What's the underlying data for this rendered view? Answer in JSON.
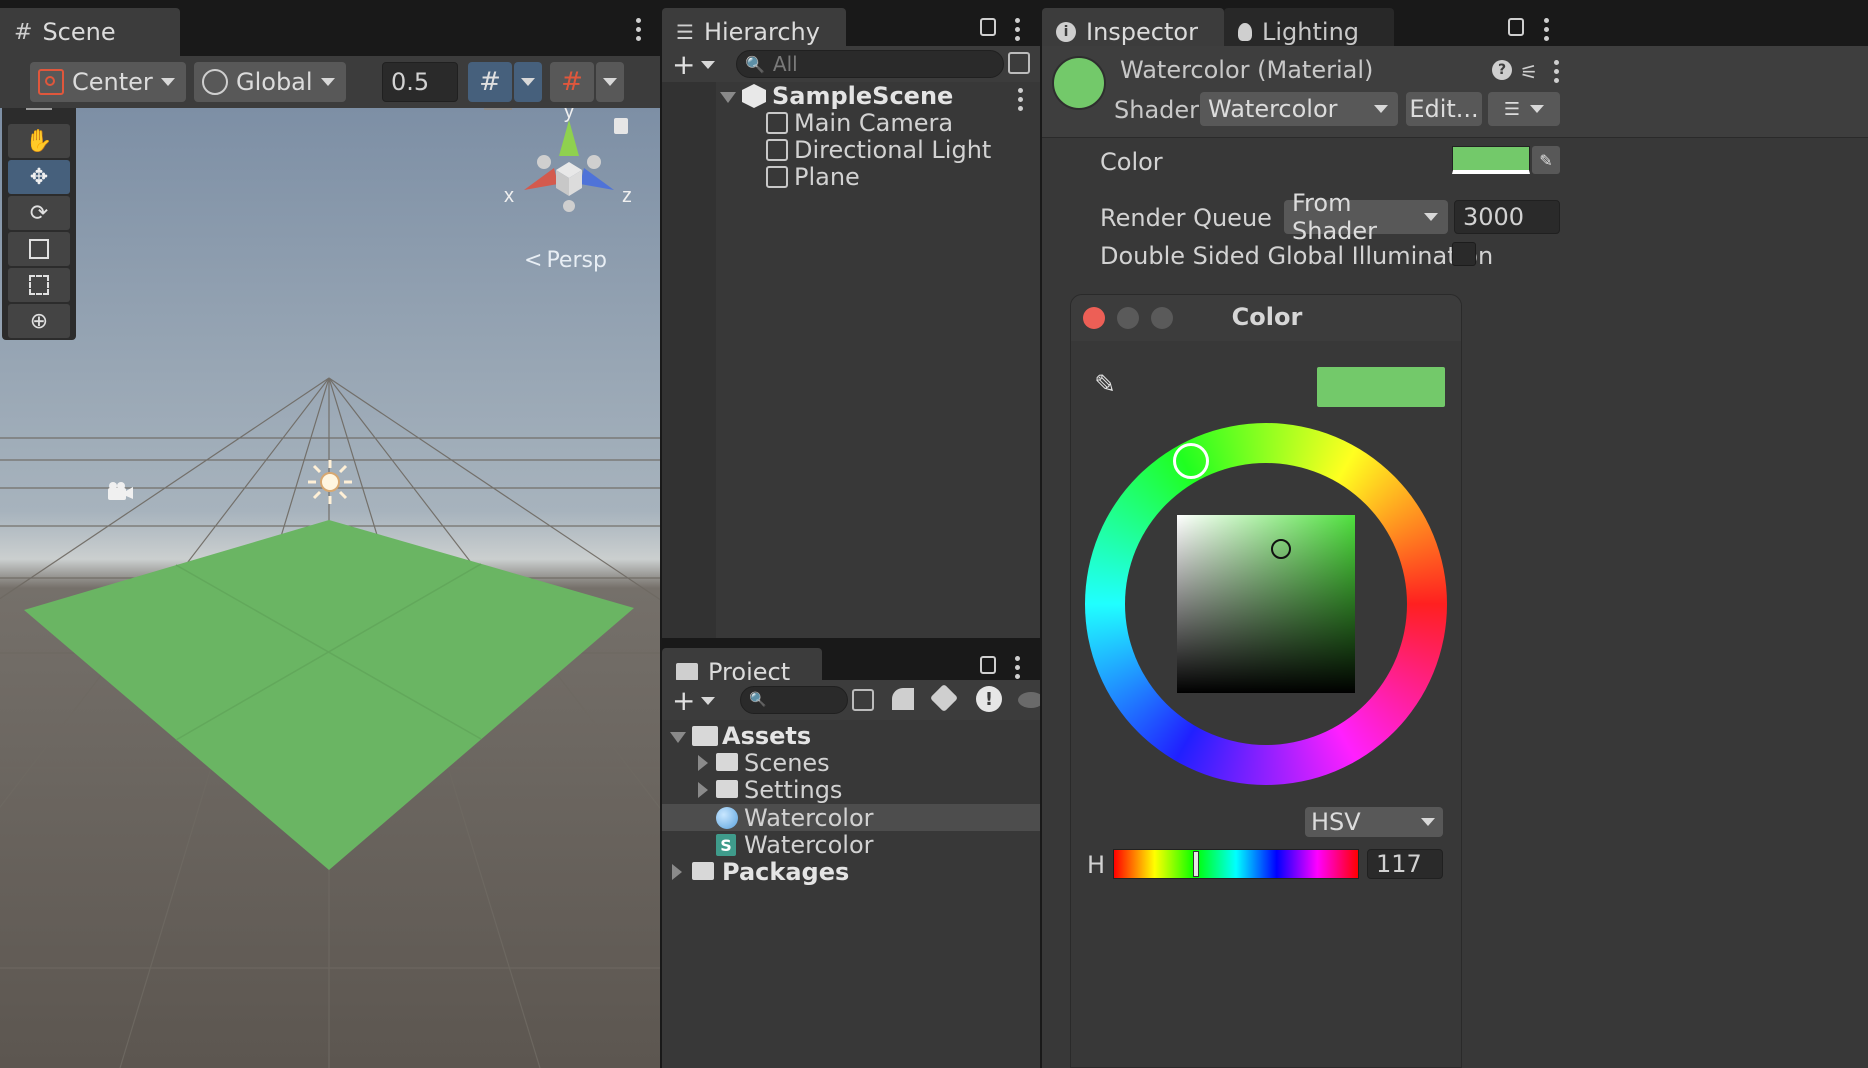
{
  "scene": {
    "tab": "Scene",
    "pivot": "Center",
    "space": "Global",
    "snap_value": "0.5",
    "gizmo_axes": {
      "x": "x",
      "y": "y",
      "z": "z"
    },
    "projection": "Persp"
  },
  "hierarchy": {
    "tab": "Hierarchy",
    "search_placeholder": "All",
    "scene_name": "SampleScene",
    "items": [
      "Main Camera",
      "Directional Light",
      "Plane"
    ]
  },
  "project": {
    "tab": "Project",
    "root": "Assets",
    "folders": [
      "Scenes",
      "Settings"
    ],
    "assets": [
      {
        "name": "Watercolor",
        "type": "material",
        "selected": true
      },
      {
        "name": "Watercolor",
        "type": "shader",
        "selected": false
      }
    ],
    "packages": "Packages",
    "shader_badge": "S"
  },
  "inspector": {
    "tabs": [
      "Inspector",
      "Lighting"
    ],
    "material_title": "Watercolor (Material)",
    "shader_label": "Shader",
    "shader_value": "Watercolor",
    "edit_label": "Edit...",
    "color_label": "Color",
    "render_queue_label": "Render Queue",
    "render_queue_mode": "From Shader",
    "render_queue_value": "3000",
    "double_sided_label": "Double Sided Global Illumination",
    "double_sided_checked": false
  },
  "color_picker": {
    "title": "Color",
    "mode": "HSV",
    "h_label": "H",
    "h_value": "117",
    "current_color": "#73c96a"
  },
  "colors": {
    "material_green": "#73c96a",
    "plane_green": "#6ab563",
    "accent_blue": "#46607c",
    "close_red": "#ed5f56"
  }
}
